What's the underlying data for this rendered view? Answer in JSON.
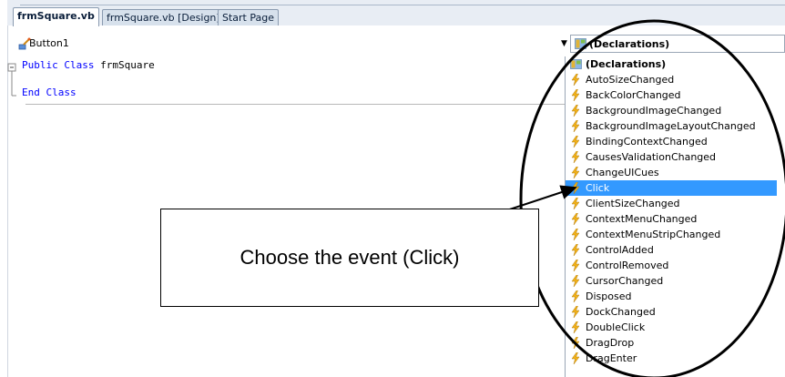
{
  "tabs": [
    {
      "label": "frmSquare.vb",
      "active": true
    },
    {
      "label": "frmSquare.vb [Design]",
      "active": false
    },
    {
      "label": "Start Page",
      "active": false
    }
  ],
  "navbar": {
    "object_combo_value": "Button1",
    "event_combo_value": "(Declarations)"
  },
  "code": {
    "line1_keyword": "Public Class ",
    "line1_name": "frmSquare",
    "line2": "End Class"
  },
  "event_list": [
    {
      "label": "(Declarations)",
      "icon": "declarations-icon"
    },
    {
      "label": "AutoSizeChanged",
      "icon": "event-lightning-icon"
    },
    {
      "label": "BackColorChanged",
      "icon": "event-lightning-icon"
    },
    {
      "label": "BackgroundImageChanged",
      "icon": "event-lightning-icon"
    },
    {
      "label": "BackgroundImageLayoutChanged",
      "icon": "event-lightning-icon"
    },
    {
      "label": "BindingContextChanged",
      "icon": "event-lightning-icon"
    },
    {
      "label": "CausesValidationChanged",
      "icon": "event-lightning-icon"
    },
    {
      "label": "ChangeUICues",
      "icon": "event-lightning-icon"
    },
    {
      "label": "Click",
      "icon": "event-lightning-icon",
      "selected": true
    },
    {
      "label": "ClientSizeChanged",
      "icon": "event-lightning-icon"
    },
    {
      "label": "ContextMenuChanged",
      "icon": "event-lightning-icon"
    },
    {
      "label": "ContextMenuStripChanged",
      "icon": "event-lightning-icon"
    },
    {
      "label": "ControlAdded",
      "icon": "event-lightning-icon"
    },
    {
      "label": "ControlRemoved",
      "icon": "event-lightning-icon"
    },
    {
      "label": "CursorChanged",
      "icon": "event-lightning-icon"
    },
    {
      "label": "Disposed",
      "icon": "event-lightning-icon"
    },
    {
      "label": "DockChanged",
      "icon": "event-lightning-icon"
    },
    {
      "label": "DoubleClick",
      "icon": "event-lightning-icon"
    },
    {
      "label": "DragDrop",
      "icon": "event-lightning-icon"
    },
    {
      "label": "DragEnter",
      "icon": "event-lightning-icon"
    }
  ],
  "callout": {
    "text": "Choose the event (Click)"
  },
  "colors": {
    "selection": "#3399ff",
    "keyword": "#0000ff",
    "lightning": "#f2b21a"
  }
}
